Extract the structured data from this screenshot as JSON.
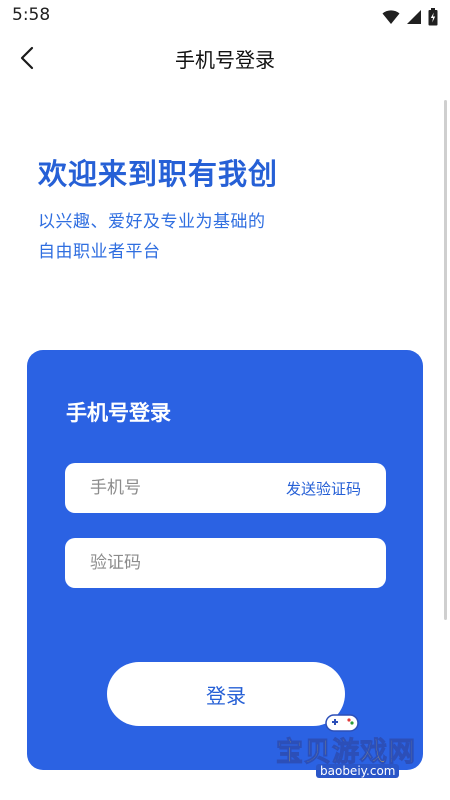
{
  "status_bar": {
    "time": "5:58",
    "icons": [
      "wifi-icon",
      "signal-icon",
      "battery-icon"
    ]
  },
  "app_bar": {
    "title": "手机号登录",
    "back_icon": "chevron-left-icon"
  },
  "welcome": {
    "title": "欢迎来到职有我创",
    "subtitle_line1": "以兴趣、爱好及专业为基础的",
    "subtitle_line2": "自由职业者平台"
  },
  "login_card": {
    "title": "手机号登录",
    "phone_placeholder": "手机号",
    "phone_value": "",
    "send_code_label": "发送验证码",
    "code_placeholder": "验证码",
    "code_value": "",
    "login_label": "登录"
  },
  "watermark": {
    "text": "宝贝游戏网",
    "url": "baobeiy.com"
  },
  "colors": {
    "accent": "#2b62e3",
    "text_blue": "#2660d6",
    "background": "#ffffff"
  }
}
